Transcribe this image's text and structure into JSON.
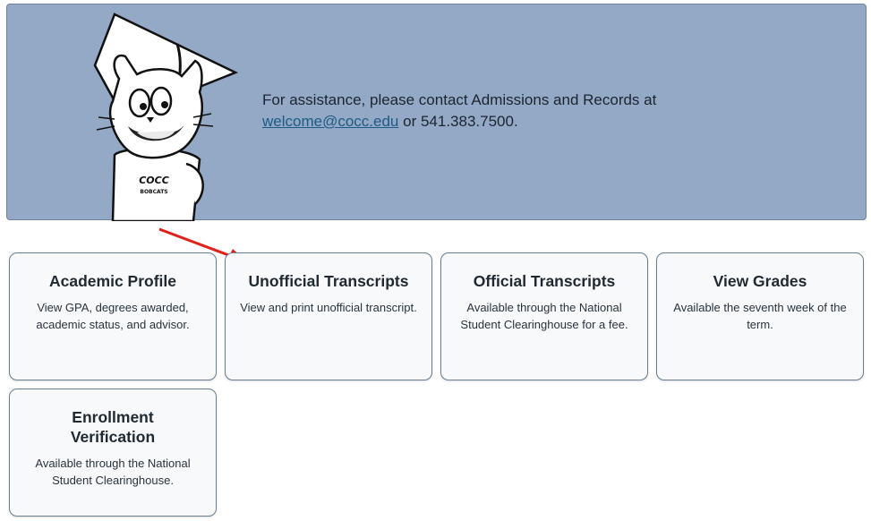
{
  "banner": {
    "assist_text": "For assistance, please contact Admissions and Records at",
    "email": "welcome@cocc.edu",
    "phone_text": " or 541.383.7500.",
    "shirt_line1": "COCC",
    "shirt_line2": "BOBCATS"
  },
  "cards": [
    {
      "title": "Academic Profile",
      "desc": "View GPA, degrees awarded, academic status, and advisor."
    },
    {
      "title": "Unofficial Transcripts",
      "desc": "View and print unofficial transcript."
    },
    {
      "title": "Official Transcripts",
      "desc": "Available through the National Student Clearinghouse for a fee."
    },
    {
      "title": "View Grades",
      "desc": "Available the seventh week of the term."
    },
    {
      "title": "Enrollment Verification",
      "desc": "Available through the National Student Clearinghouse."
    }
  ],
  "colors": {
    "banner_bg": "#94a9c6",
    "card_bg": "#f8f9fa",
    "annotation_arrow": "#e0201b",
    "link": "#1d5b86"
  }
}
